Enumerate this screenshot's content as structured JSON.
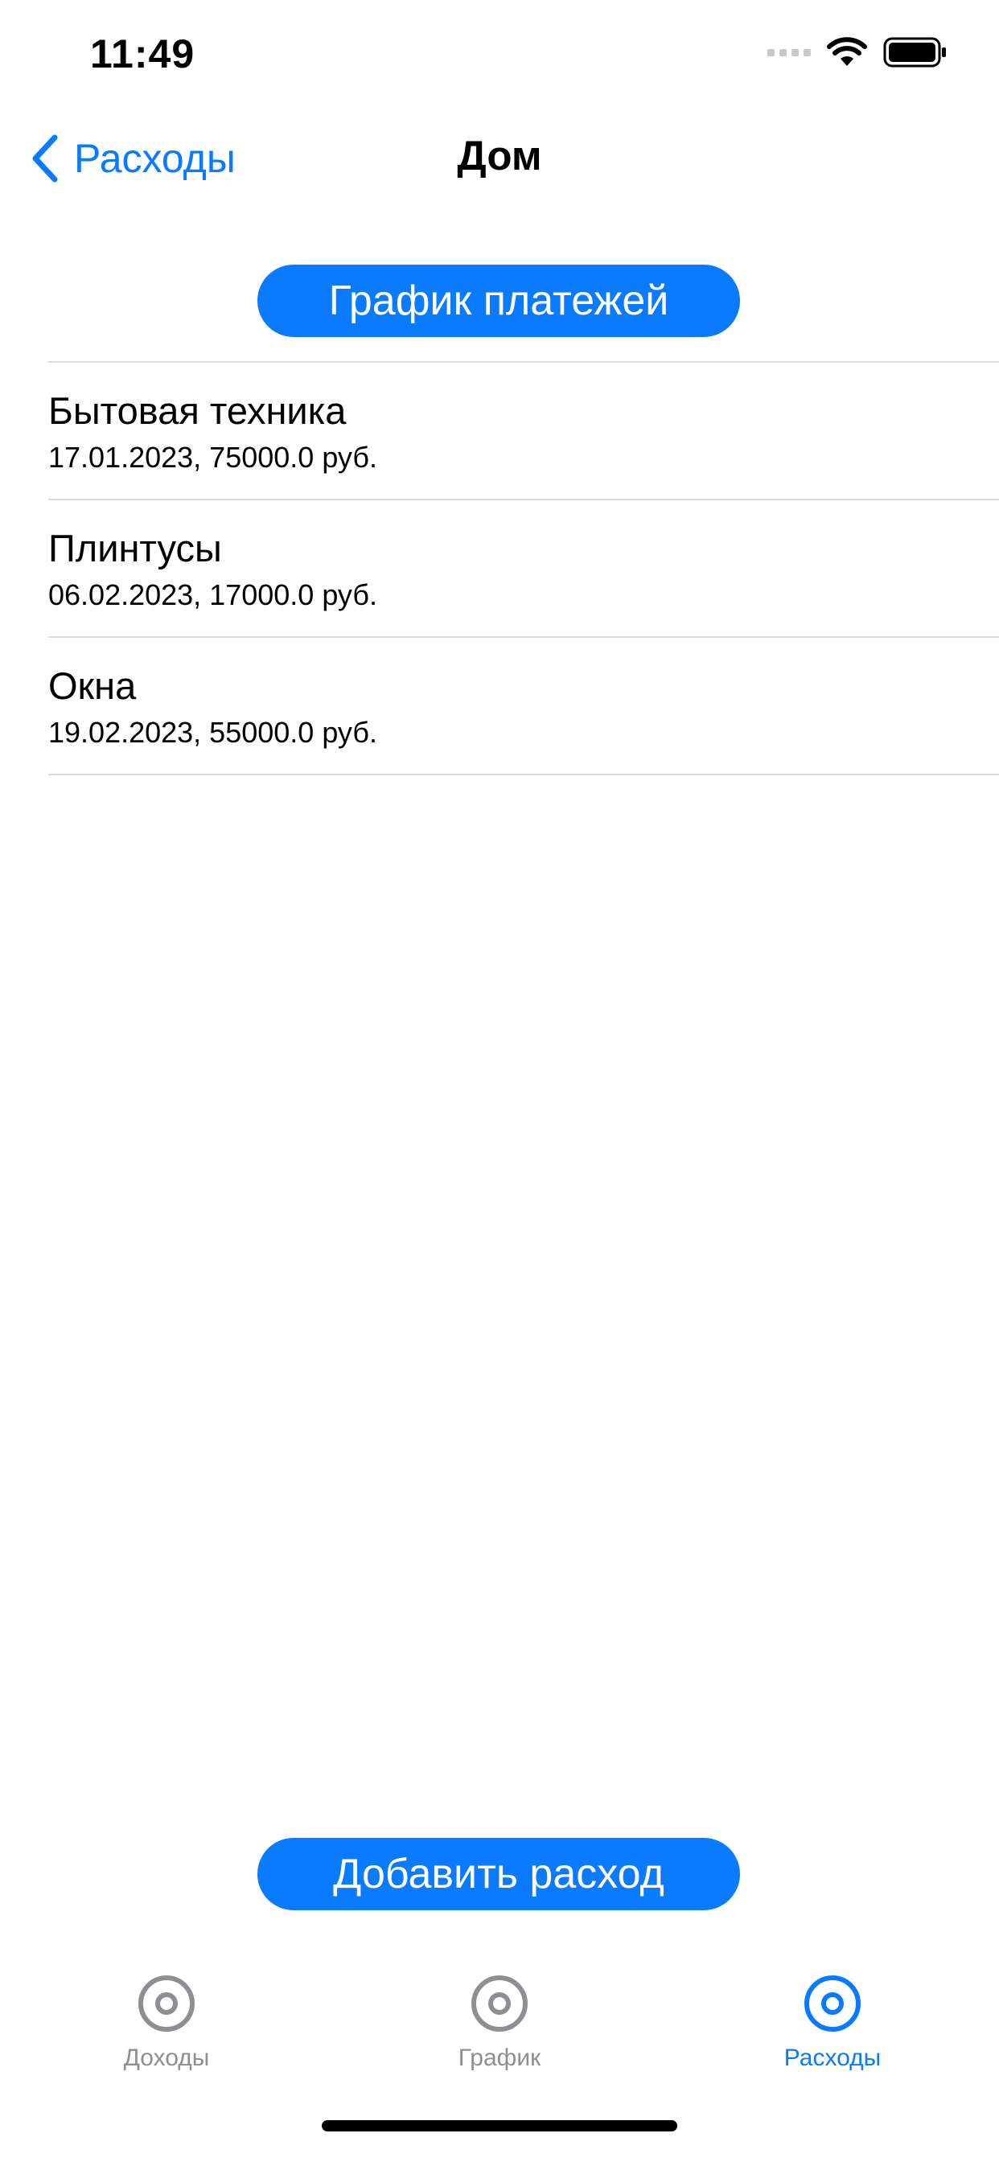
{
  "status_bar": {
    "time": "11:49"
  },
  "nav": {
    "back_label": "Расходы",
    "title": "Дом"
  },
  "schedule_button_label": "График платежей",
  "expenses": [
    {
      "title": "Бытовая техника",
      "subtitle": "17.01.2023, 75000.0 руб."
    },
    {
      "title": "Плинтусы",
      "subtitle": "06.02.2023, 17000.0 руб."
    },
    {
      "title": "Окна",
      "subtitle": "19.02.2023, 55000.0 руб."
    }
  ],
  "add_button_label": "Добавить расход",
  "tab_bar": {
    "tabs": [
      {
        "label": "Доходы",
        "icon": "circle-dot-icon",
        "active": false
      },
      {
        "label": "График",
        "icon": "circle-dot-icon",
        "active": false
      },
      {
        "label": "Расходы",
        "icon": "circle-dot-icon",
        "active": true
      }
    ]
  },
  "colors": {
    "accent": "#0a7aff",
    "tab_inactive": "#8e8e93",
    "divider": "#dcdce0"
  }
}
